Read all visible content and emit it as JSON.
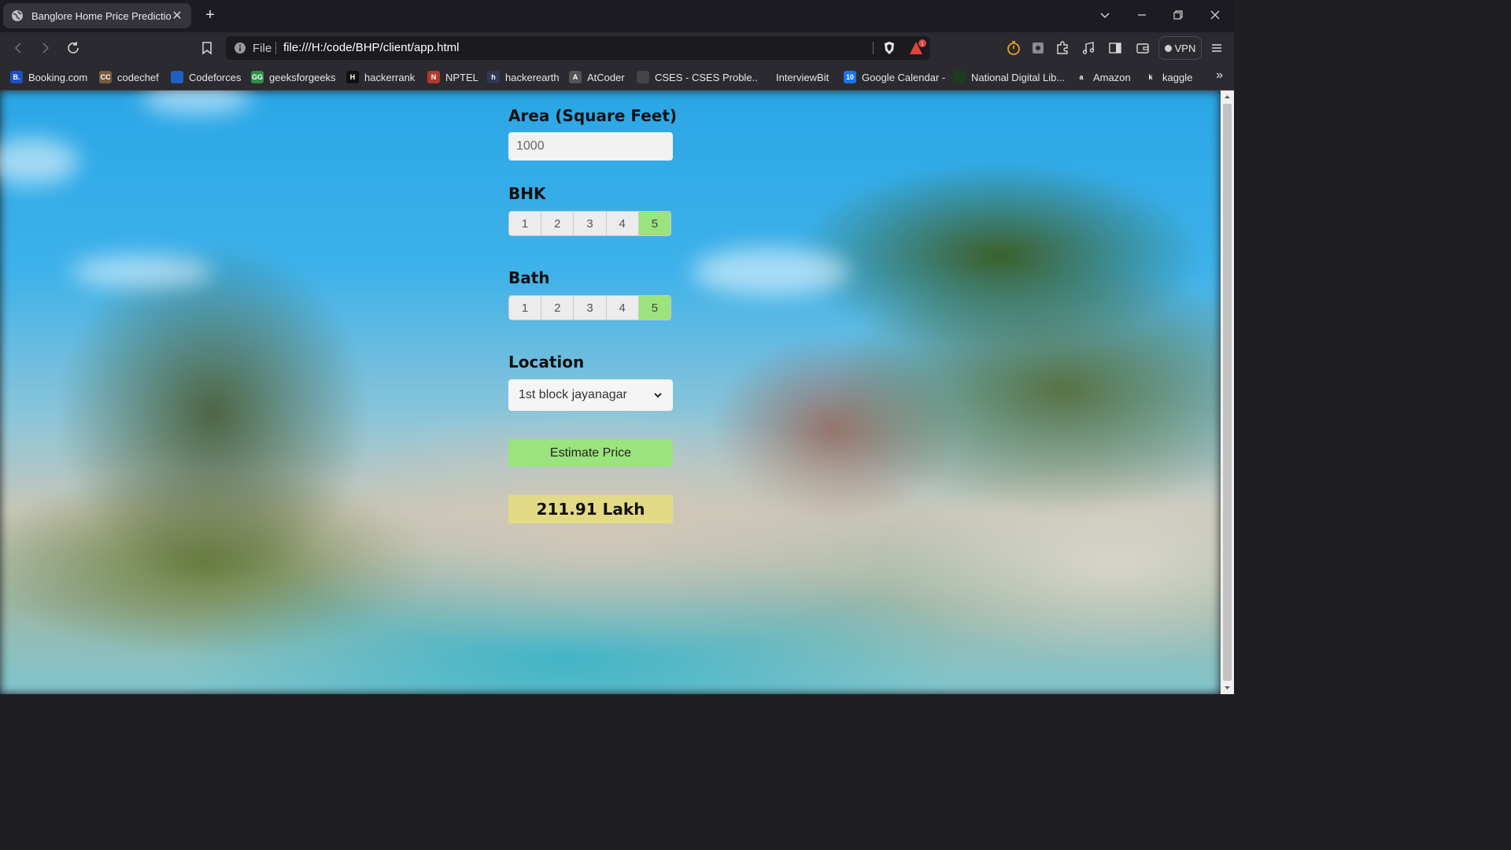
{
  "browser": {
    "tab": {
      "title": "Banglore Home Price Prediction",
      "close": "✕"
    },
    "new_tab": "+",
    "address": {
      "scheme": "File",
      "url": "file:///H:/code/BHP/client/app.html"
    },
    "vpn_label": "VPN",
    "bookmarks": [
      {
        "label": "Booking.com",
        "icon": "booking-icon",
        "fav": "B.",
        "color": "#1f4fbf"
      },
      {
        "label": "codechef",
        "icon": "codechef-icon",
        "fav": "CC",
        "color": "#7a5a3c"
      },
      {
        "label": "Codeforces",
        "icon": "codeforces-icon",
        "fav": "",
        "color": "#1f5fbf"
      },
      {
        "label": "geeksforgeeks",
        "icon": "geeksforgeeks-icon",
        "fav": "GG",
        "color": "#2f8d46"
      },
      {
        "label": "hackerrank",
        "icon": "hackerrank-icon",
        "fav": "H",
        "color": "#111111"
      },
      {
        "label": "NPTEL",
        "icon": "nptel-icon",
        "fav": "N",
        "color": "#b03a2e"
      },
      {
        "label": "hackerearth",
        "icon": "hackerearth-icon",
        "fav": "h",
        "color": "#323754"
      },
      {
        "label": "AtCoder",
        "icon": "atcoder-icon",
        "fav": "A",
        "color": "#555555"
      },
      {
        "label": "CSES - CSES Proble...",
        "icon": "globe-icon",
        "fav": "",
        "color": "#444448"
      },
      {
        "label": "InterviewBit",
        "icon": "interviewbit-icon",
        "fav": "",
        "color": "#2a2a30"
      },
      {
        "label": "Google Calendar -",
        "icon": "google-calendar-icon",
        "fav": "10",
        "color": "#1a73e8"
      },
      {
        "label": "National Digital Lib...",
        "icon": "ndl-icon",
        "fav": "",
        "color": "#1e3d1e"
      },
      {
        "label": "Amazon",
        "icon": "amazon-icon",
        "fav": "a",
        "color": "#2a2a30"
      },
      {
        "label": "kaggle",
        "icon": "kaggle-icon",
        "fav": "k",
        "color": "#2a2a30"
      }
    ],
    "bookmarks_more": "»"
  },
  "form": {
    "area": {
      "label": "Area (Square Feet)",
      "value": "1000"
    },
    "bhk": {
      "label": "BHK",
      "options": [
        "1",
        "2",
        "3",
        "4",
        "5"
      ],
      "selected": "5"
    },
    "bath": {
      "label": "Bath",
      "options": [
        "1",
        "2",
        "3",
        "4",
        "5"
      ],
      "selected": "5"
    },
    "location": {
      "label": "Location",
      "value": "1st block jayanagar"
    },
    "estimate_button": "Estimate Price",
    "result": "211.91 Lakh"
  },
  "colors": {
    "accent_green": "#9be37d",
    "result_bg": "#e3da85"
  }
}
